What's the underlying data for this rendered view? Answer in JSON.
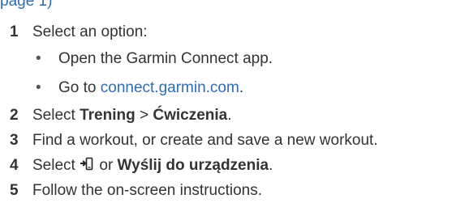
{
  "top_cutoff_text": "page 1)",
  "steps": [
    {
      "number": "1",
      "text": "Select an option:",
      "sub_items": [
        {
          "bullet": "•",
          "text": "Open the Garmin Connect app."
        },
        {
          "bullet": "•",
          "text_prefix": "Go to ",
          "link": "connect.garmin.com",
          "text_suffix": "."
        }
      ]
    },
    {
      "number": "2",
      "prefix": "Select ",
      "bold1": "Trening",
      "separator": " > ",
      "bold2": "Ćwiczenia",
      "suffix": "."
    },
    {
      "number": "3",
      "text": "Find a workout, or create and save a new workout."
    },
    {
      "number": "4",
      "prefix": "Select ",
      "icon": "send-to-device-icon",
      "middle": " or ",
      "bold": "Wyślij do urządzenia",
      "suffix": "."
    },
    {
      "number": "5",
      "text": "Follow the on-screen instructions."
    }
  ]
}
